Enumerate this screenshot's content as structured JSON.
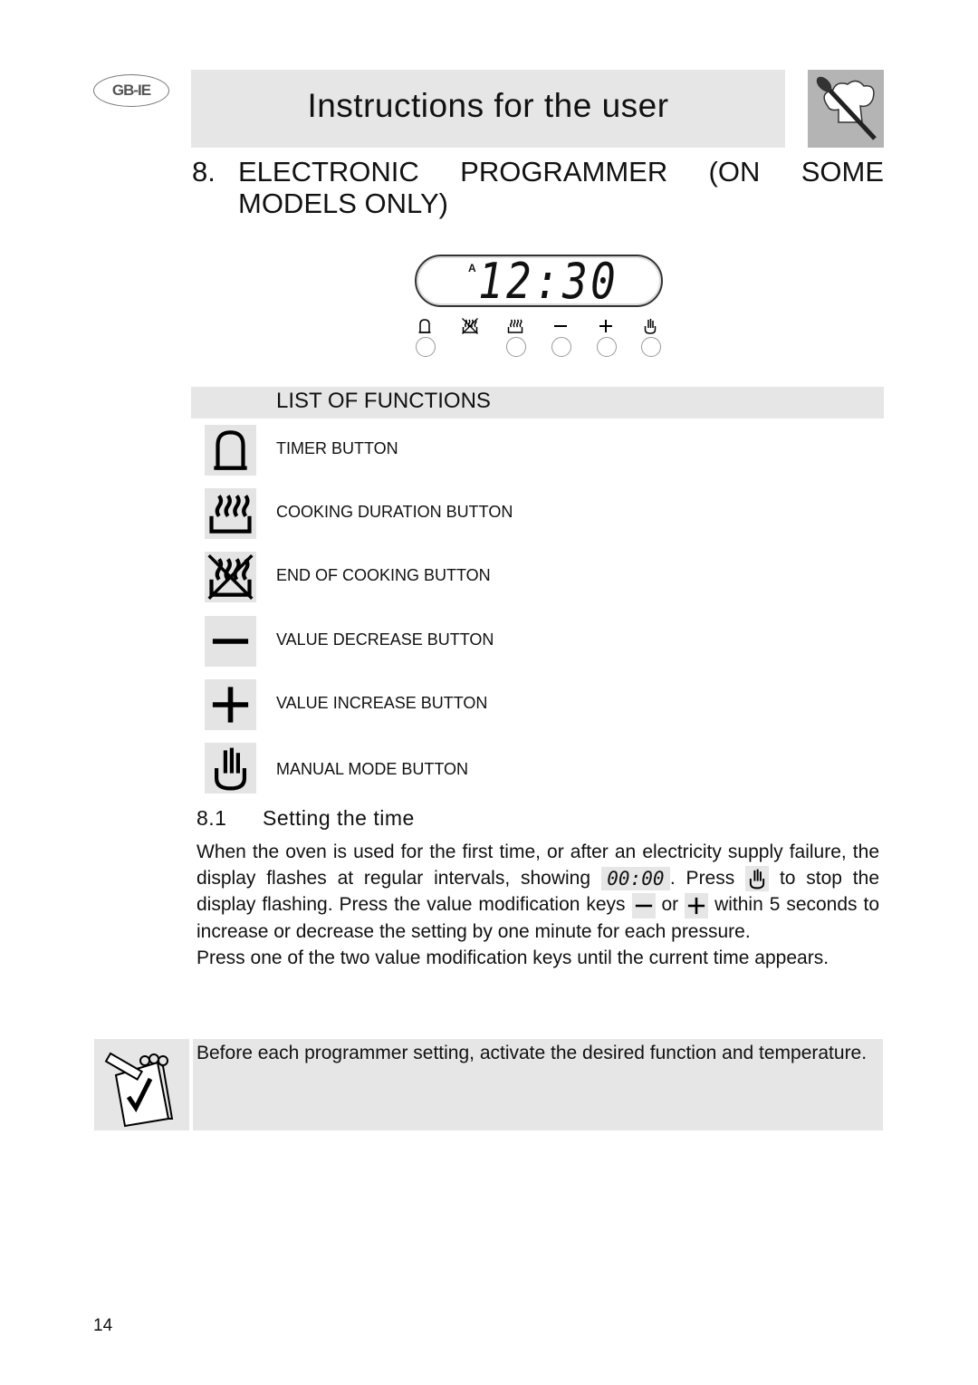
{
  "header": {
    "badge": "GB-IE",
    "title": "Instructions for the user",
    "chef_icon": "chef-hat-spoon-icon"
  },
  "section": {
    "number": "8.",
    "title_line1": "ELECTRONIC PROGRAMMER (ON SOME",
    "title_line2": "MODELS ONLY)"
  },
  "display": {
    "indicator": "A",
    "time": "12:30"
  },
  "keypad": [
    {
      "icon": "bell-icon",
      "symbol": "♫"
    },
    {
      "icon": "end-cooking-icon"
    },
    {
      "icon": "cooking-duration-icon"
    },
    {
      "icon": "minus-icon",
      "symbol": "–"
    },
    {
      "icon": "plus-icon",
      "symbol": "+"
    },
    {
      "icon": "hand-icon"
    }
  ],
  "functions": {
    "title": "LIST OF FUNCTIONS",
    "items": [
      {
        "icon": "bell-icon",
        "label": "TIMER BUTTON"
      },
      {
        "icon": "cooking-duration-icon",
        "label": "COOKING DURATION BUTTON"
      },
      {
        "icon": "end-cooking-icon",
        "label": "END OF COOKING BUTTON"
      },
      {
        "icon": "minus-icon",
        "label": "VALUE DECREASE BUTTON"
      },
      {
        "icon": "plus-icon",
        "label": "VALUE INCREASE BUTTON"
      },
      {
        "icon": "hand-icon",
        "label": "MANUAL MODE BUTTON"
      }
    ]
  },
  "subsection": {
    "number": "8.1",
    "title": "Setting the time"
  },
  "body": {
    "p1a": "When the oven is used for the first time, or after an electricity supply failure, the display flashes at regular intervals, showing",
    "display_value": "00:00",
    "p1b": ". Press",
    "p1c": "to stop the display flashing. Press the value modification keys",
    "p1d": "or",
    "p1e": "within 5 seconds to increase or decrease the setting by one minute for each pressure.",
    "p2": "Press one of the two value modification keys until the current time appears."
  },
  "note": {
    "icon": "notepad-check-icon",
    "text": "Before each programmer setting, activate the desired function and temperature."
  },
  "page_number": "14"
}
